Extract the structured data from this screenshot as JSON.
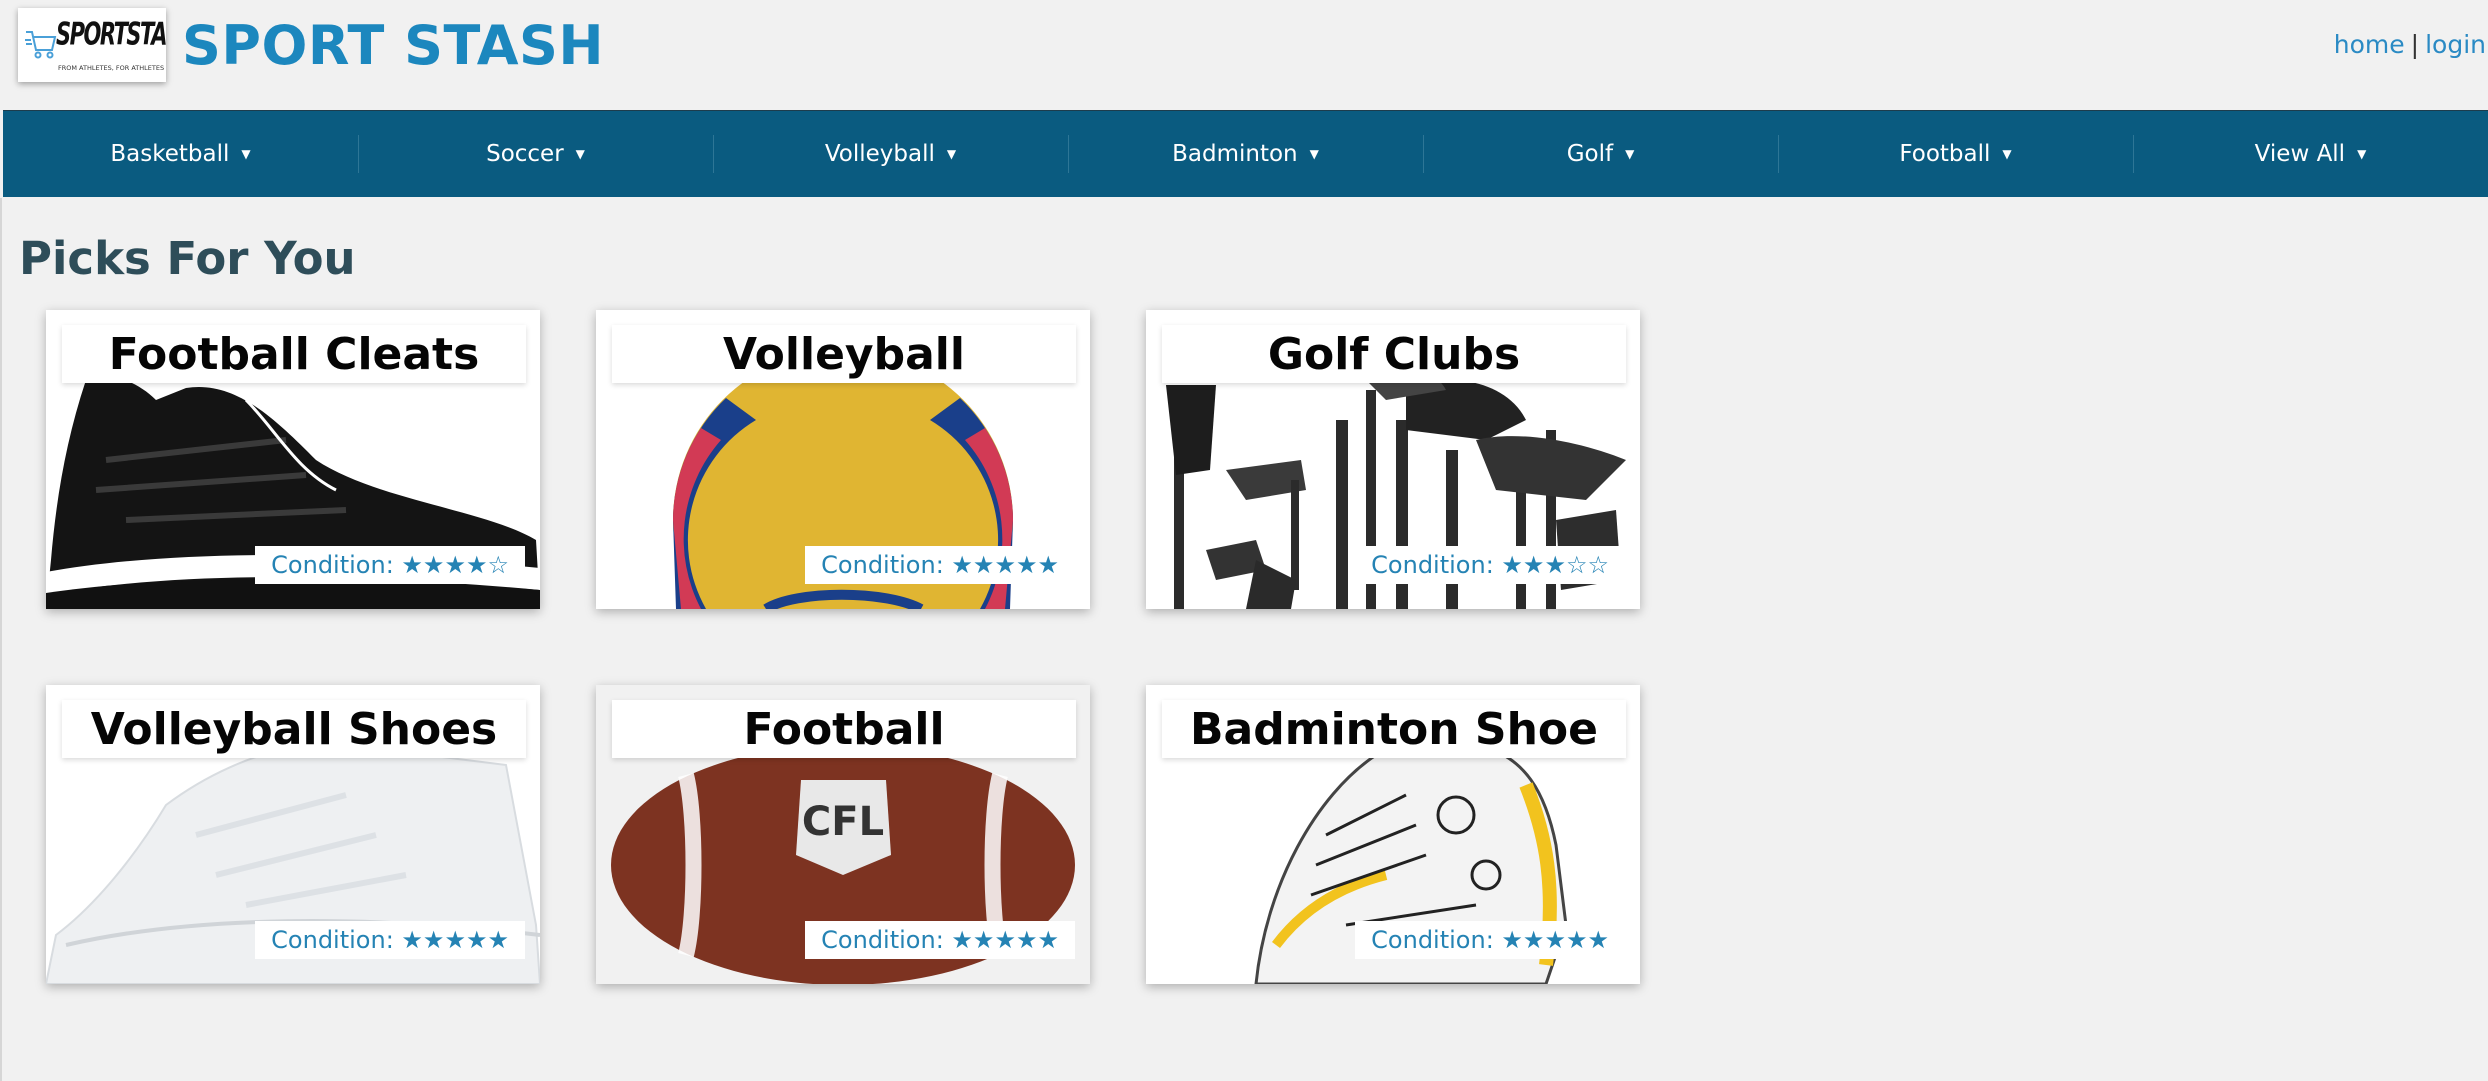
{
  "header": {
    "logo": {
      "brand": "SPORTSTASH",
      "tagline": "FROM ATHLETES, FOR ATHLETES"
    },
    "title": "SPORT STASH",
    "links": [
      {
        "label": "home"
      },
      {
        "label": "login"
      }
    ],
    "link_separator": "|"
  },
  "nav": {
    "items": [
      {
        "label": "Basketball",
        "icon": "caret-down-icon"
      },
      {
        "label": "Soccer",
        "icon": "caret-down-icon"
      },
      {
        "label": "Volleyball",
        "icon": "caret-down-icon"
      },
      {
        "label": "Badminton",
        "icon": "caret-down-icon"
      },
      {
        "label": "Golf",
        "icon": "caret-down-icon"
      },
      {
        "label": "Football",
        "icon": "caret-down-icon"
      },
      {
        "label": "View All",
        "icon": "caret-down-icon"
      }
    ],
    "caret": "▼"
  },
  "main": {
    "section_title": "Picks For You",
    "cards": [
      {
        "title": "Football Cleats",
        "condition": "Condition: ★★★★☆",
        "rating": 4,
        "max_rating": 5,
        "image": "football-cleats-image"
      },
      {
        "title": "Volleyball",
        "condition": "Condition: ★★★★★",
        "rating": 5,
        "max_rating": 5,
        "image": "volleyball-image"
      },
      {
        "title": "Golf Clubs",
        "condition": "Condition: ★★★☆☆",
        "rating": 3,
        "max_rating": 5,
        "image": "golf-clubs-image"
      },
      {
        "title": "Volleyball Shoes",
        "condition": "Condition: ★★★★★",
        "rating": 5,
        "max_rating": 5,
        "image": "volleyball-shoes-image"
      },
      {
        "title": "Football",
        "condition": "Condition: ★★★★★",
        "rating": 5,
        "max_rating": 5,
        "image": "football-image"
      },
      {
        "title": "Badminton Shoe",
        "condition": "Condition: ★★★★★",
        "rating": 5,
        "max_rating": 5,
        "image": "badminton-shoe-image"
      }
    ]
  },
  "colors": {
    "background": "#f1f1f1",
    "brand": "#1c87be",
    "nav": "#0a5b80",
    "heading": "#2e4d59",
    "condition_text": "#2583b4"
  }
}
